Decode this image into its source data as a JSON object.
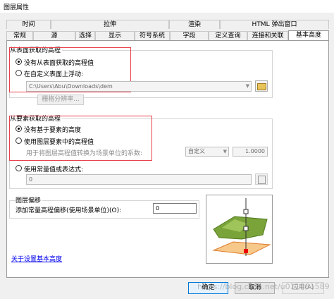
{
  "window": {
    "title": "图层属性"
  },
  "tabs_row1": [
    {
      "label": "时间"
    },
    {
      "label": "拉伸"
    },
    {
      "label": "渲染"
    },
    {
      "label": "HTML 弹出窗口"
    }
  ],
  "tabs_row2": [
    {
      "label": "常规"
    },
    {
      "label": "源"
    },
    {
      "label": "选择"
    },
    {
      "label": "显示"
    },
    {
      "label": "符号系统"
    },
    {
      "label": "字段"
    },
    {
      "label": "定义查询"
    },
    {
      "label": "连接和关联"
    },
    {
      "label": "基本高度"
    }
  ],
  "surface_group": {
    "title": "从表面获取的高程",
    "option_none": "没有从表面获取的高程值",
    "option_float": "在自定义表面上浮动:",
    "path_value": "C:\\Users\\Abu\\Downloads\\dem",
    "raster_button": "栅格分辨率..."
  },
  "feature_group": {
    "title": "从要素获取的高程",
    "option_none": "没有基于要素的高度",
    "option_use": "使用图层要素中的高程值",
    "factor_label": "用于将图层高程值转换为场景单位的系数:",
    "unit_select": "自定义",
    "factor_value": "1.0000",
    "option_constant": "使用常量值或表达式:",
    "constant_value": "0"
  },
  "offset_group": {
    "title": "图层偏移",
    "label": "添加常量高程偏移(使用场景单位)(O):",
    "value": "0"
  },
  "link": "关于设置基本高度",
  "buttons": {
    "ok": "确定",
    "cancel": "取消",
    "apply": "应用(A)"
  },
  "watermark": "https://blog.csdn.net/u011881589",
  "colors": {
    "highlight_box": "#e8414c",
    "link": "#0000ee",
    "terrain": "#7aa33a",
    "plane": "#f6c98a"
  }
}
